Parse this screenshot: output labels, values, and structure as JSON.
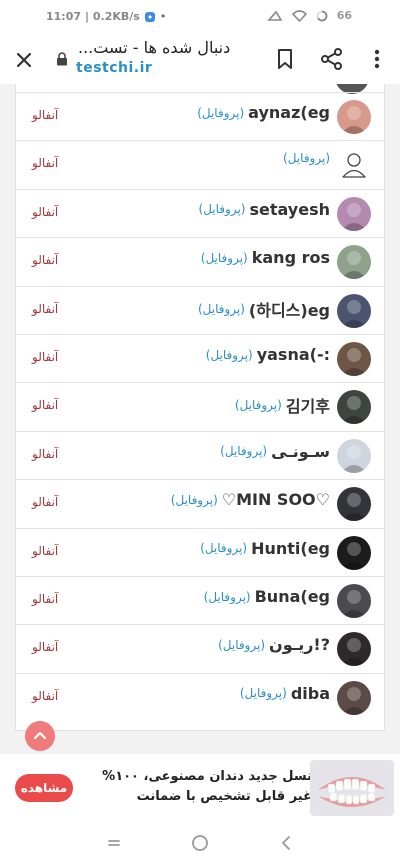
{
  "status_bar": {
    "time": "11:07",
    "net_speed": "| 0.2KB/s",
    "battery": "66"
  },
  "toolbar": {
    "title": "دنبال شده ها - تست...",
    "url": "testchi.ir",
    "close_icon": "close-icon",
    "lock_icon": "lock-icon",
    "bookmark_icon": "bookmark-icon",
    "share_icon": "share-icon",
    "more_icon": "more-vert-icon"
  },
  "rows": [
    {
      "name": "aynaz(eg",
      "profile": "(پروفایل)",
      "action": "آنفالو",
      "avatar_color": "#d79a8a"
    },
    {
      "name": "",
      "profile": "(پروفایل)",
      "action": "آنفالو",
      "avatar_color": ""
    },
    {
      "name": "setayesh",
      "profile": "(پروفایل)",
      "action": "آنفالو",
      "avatar_color": "#b58ab0"
    },
    {
      "name": "kang ros",
      "profile": "(پروفایل)",
      "action": "آنفالو",
      "avatar_color": "#8ea28c"
    },
    {
      "name": "(하디스)eg",
      "profile": "(پروفایل)",
      "action": "آنفالو",
      "avatar_color": "#4d5470"
    },
    {
      "name": "yasna(-:",
      "profile": "(پروفایل)",
      "action": "آنفالو",
      "avatar_color": "#6e5646"
    },
    {
      "name": "김기후",
      "profile": "(پروفایل)",
      "action": "آنفالو",
      "avatar_color": "#3e4540"
    },
    {
      "name": "سـونـی",
      "profile": "(پروفایل)",
      "action": "آنفالو",
      "avatar_color": "#cfd4de"
    },
    {
      "name": "♡MIN SOO♡",
      "profile": "(پروفایل)",
      "action": "آنفالو",
      "avatar_color": "#33333a"
    },
    {
      "name": "Hunti(eg",
      "profile": "(پروفایل)",
      "action": "آنفالو",
      "avatar_color": "#1c1c1c"
    },
    {
      "name": "Buna(eg",
      "profile": "(پروفایل)",
      "action": "آنفالو",
      "avatar_color": "#4a4a4f"
    },
    {
      "name": "ریـون!?",
      "profile": "(پروفایل)",
      "action": "آنفالو",
      "avatar_color": "#2e2a2c"
    },
    {
      "name": "diba",
      "profile": "(پروفایل)",
      "action": "آنفالو",
      "avatar_color": "#5b4a46"
    }
  ],
  "ad": {
    "text": "نسل جدید دندان مصنوعی، ۱۰۰% غیر قابل تشخیص با ضمانت",
    "button": "مشاهده"
  },
  "nav": {
    "recent": "recents-icon",
    "home": "home-icon",
    "back": "back-icon"
  },
  "colors": {
    "link": "#2a8fc9",
    "unfollow": "#a33b3b",
    "ad_button": "#ea4a4a",
    "scroll_top": "#ef7b7b"
  }
}
